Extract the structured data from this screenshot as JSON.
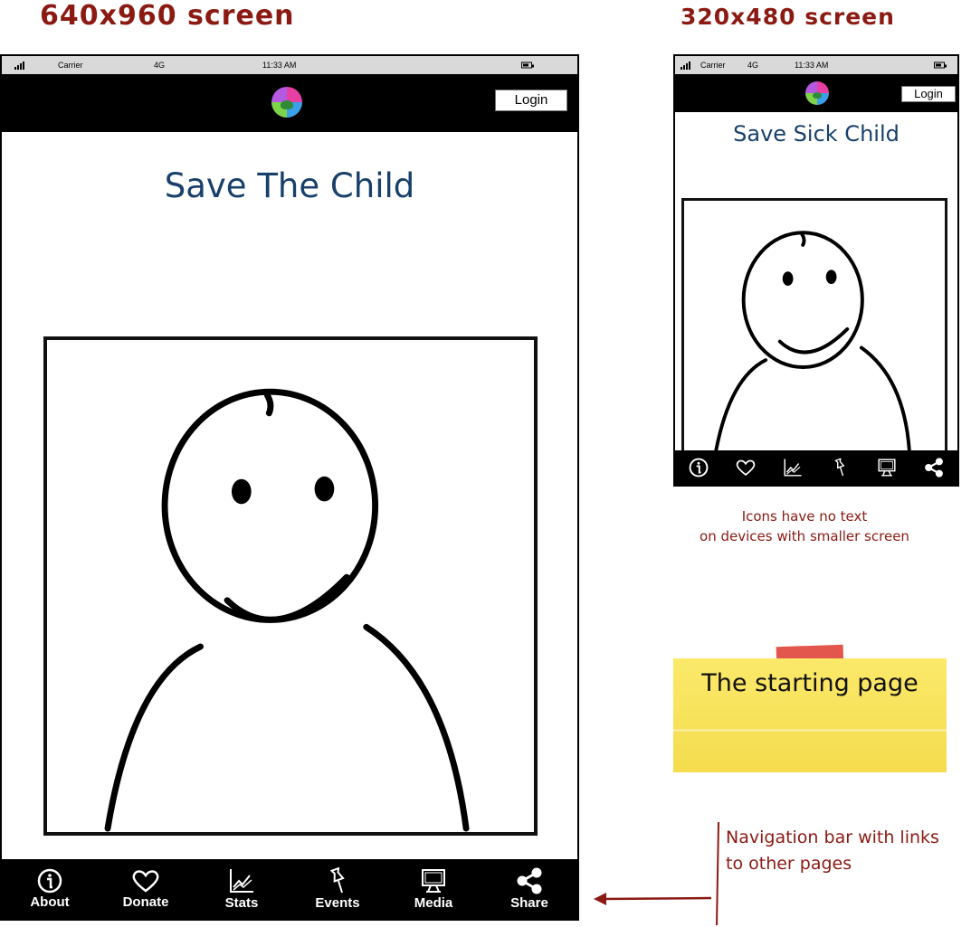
{
  "headings": {
    "large": "640x960 screen",
    "small": "320x480 screen"
  },
  "status_bar": {
    "carrier": "Carrier",
    "network": "4G",
    "time": "11:33 AM"
  },
  "header": {
    "login_label": "Login",
    "logo_icon": "app-logo-icon"
  },
  "large_screen": {
    "title": "Save The Child",
    "nav_items": [
      {
        "label": "About",
        "icon": "info-icon"
      },
      {
        "label": "Donate",
        "icon": "heart-icon"
      },
      {
        "label": "Stats",
        "icon": "chart-icon"
      },
      {
        "label": "Events",
        "icon": "pushpin-icon"
      },
      {
        "label": "Media",
        "icon": "monitor-icon"
      },
      {
        "label": "Share",
        "icon": "share-icon"
      }
    ]
  },
  "small_screen": {
    "title": "Save Sick Child"
  },
  "annotations": {
    "icons_note_line1": "Icons have no text",
    "icons_note_line2": "on devices with smaller screen",
    "sticky_note": "The starting page",
    "nav_note_line1": "Navigation bar with links",
    "nav_note_line2": "to other pages"
  },
  "colors": {
    "annotation": "#8b1a13",
    "page_title": "#18406a",
    "sticky_note": "#f7e25a",
    "tape": "#e0443a"
  }
}
